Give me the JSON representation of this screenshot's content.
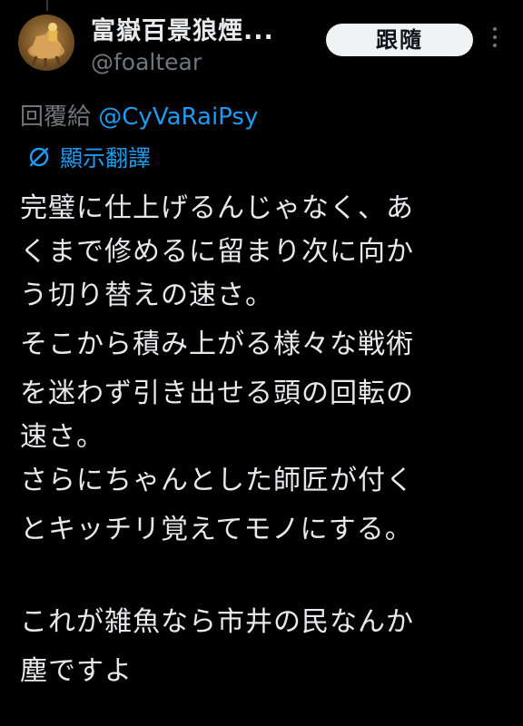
{
  "author": {
    "display_name": "富嶽百景狼煙...",
    "handle": "@foaltear",
    "avatar_icon": "horse-rider-avatar"
  },
  "follow_button": {
    "label": "跟隨"
  },
  "more_menu": {
    "icon": "more-vertical-icon"
  },
  "reply": {
    "prefix": "回覆給",
    "mention": "@CyVaRaiPsy"
  },
  "translate": {
    "icon": "translate-icon",
    "label": "顯示翻譯"
  },
  "tweet": {
    "lines": [
      "完璧に仕上げるんじゃなく、あ",
      "くまで修めるに留まり次に向か",
      "う切り替えの速さ。",
      "そこから積み上がる様々な戦術",
      "を迷わず引き出せる頭の回転の",
      "速さ。",
      "さらにちゃんとした師匠が付く",
      "とキッチリ覚えてモノにする。",
      "",
      "これが雑魚なら市井の民なんか",
      "塵ですよ"
    ]
  },
  "colors": {
    "background": "#000000",
    "text_primary": "#e7e9ea",
    "text_secondary": "#71767b",
    "accent": "#1d9bf0",
    "button_bg": "#eff3f4"
  }
}
